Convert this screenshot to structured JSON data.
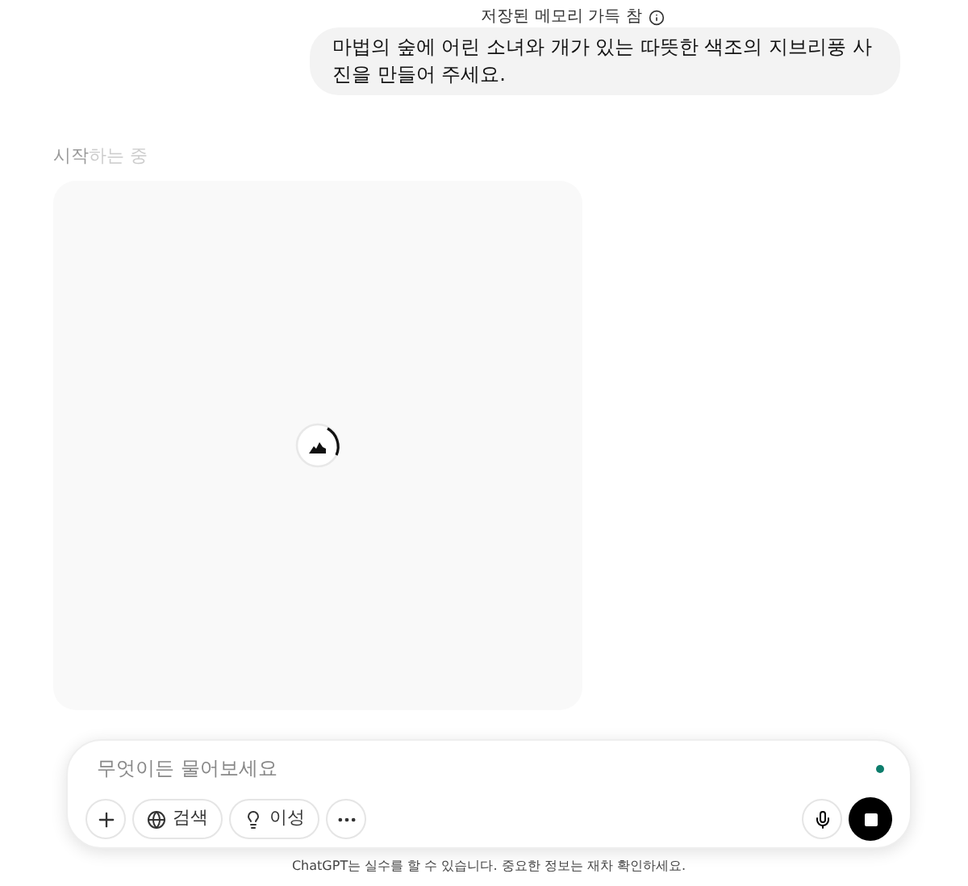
{
  "memory_notice": {
    "text": "저장된 메모리 가득 참"
  },
  "user_message": {
    "text": "마법의 숲에 어린 소녀와 개가 있는 따뜻한 색조의 지브리풍 사진을 만들어 주세요."
  },
  "status": {
    "highlight": "시작",
    "rest": "하는 중"
  },
  "image_placeholder": {
    "kind": "loading"
  },
  "composer": {
    "placeholder": "무엇이든 물어보세요",
    "buttons": [
      {
        "kind": "plus"
      },
      {
        "kind": "search",
        "label": "검색"
      },
      {
        "kind": "reason",
        "label": "이성"
      },
      {
        "kind": "more"
      }
    ]
  },
  "footer": "ChatGPT는 실수를 할 수 있습니다. 중요한 정보는 재차 확인하세요."
}
